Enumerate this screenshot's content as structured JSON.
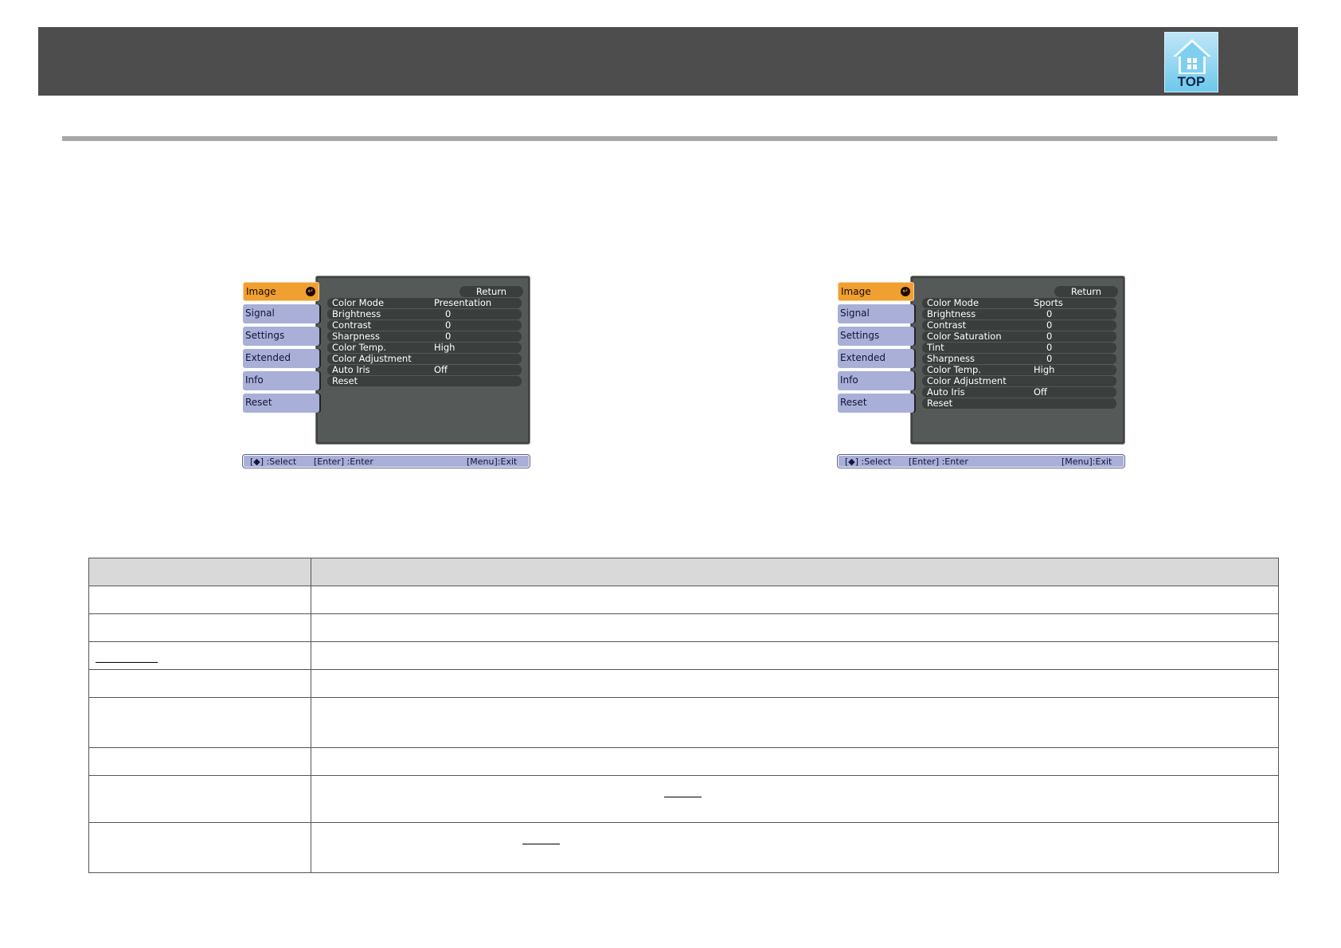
{
  "header": {
    "top_button_label": "TOP"
  },
  "menus": [
    {
      "tabs": [
        "Image",
        "Signal",
        "Settings",
        "Extended",
        "Info",
        "Reset"
      ],
      "return_label": "Return",
      "rows": [
        {
          "label": "Color Mode",
          "value": "Presentation"
        },
        {
          "label": "Brightness",
          "value": "0"
        },
        {
          "label": "Contrast",
          "value": "0"
        },
        {
          "label": "Sharpness",
          "value": "0"
        },
        {
          "label": "Color Temp.",
          "value": "High"
        },
        {
          "label": "Color Adjustment",
          "value": ""
        },
        {
          "label": "Auto Iris",
          "value": "Off"
        },
        {
          "label": "Reset",
          "value": ""
        }
      ],
      "status": {
        "select": "[◆] :Select",
        "enter": "[Enter] :Enter",
        "exit": "[Menu]:Exit"
      }
    },
    {
      "tabs": [
        "Image",
        "Signal",
        "Settings",
        "Extended",
        "Info",
        "Reset"
      ],
      "return_label": "Return",
      "rows": [
        {
          "label": "Color Mode",
          "value": "Sports"
        },
        {
          "label": "Brightness",
          "value": "0"
        },
        {
          "label": "Contrast",
          "value": "0"
        },
        {
          "label": "Color Saturation",
          "value": "0"
        },
        {
          "label": "Tint",
          "value": "0"
        },
        {
          "label": "Sharpness",
          "value": "0"
        },
        {
          "label": "Color Temp.",
          "value": "High"
        },
        {
          "label": "Color Adjustment",
          "value": ""
        },
        {
          "label": "Auto Iris",
          "value": "Off"
        },
        {
          "label": "Reset",
          "value": ""
        }
      ],
      "status": {
        "select": "[◆] :Select",
        "enter": "[Enter] :Enter",
        "exit": "[Menu]:Exit"
      }
    }
  ],
  "colors": {
    "header_bar": "#4d4d4d",
    "active_tab": "#f0a030",
    "tab": "#a9afd6",
    "panel": "#555a58",
    "table_header": "#d9d9d9"
  }
}
